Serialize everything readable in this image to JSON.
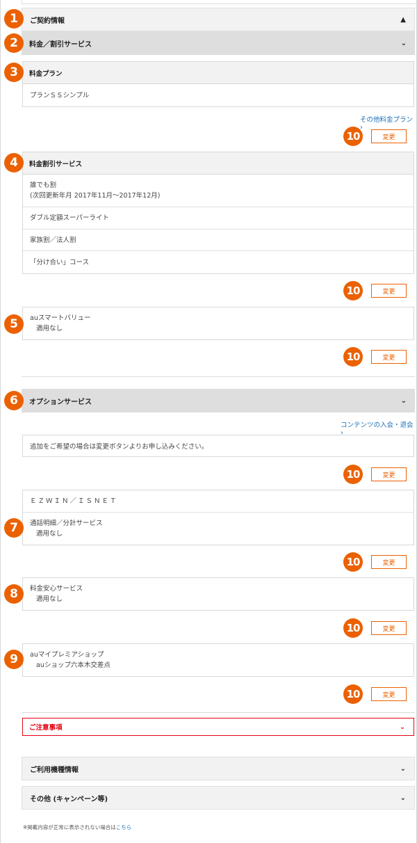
{
  "contract_header": "ご契約情報",
  "fees_header": "料金／割引サービス",
  "plan": {
    "title": "料金プラン",
    "name": "プランＳＳシンプル"
  },
  "other_plans_link": "その他料金プラン ›",
  "discounts": {
    "title": "料金割引サービス",
    "item1_line1": "誰でも割",
    "item1_line2": "(次回更新年月 2017年11月～2017年12月)",
    "item2": "ダブル定額スーパーライト",
    "item3": "家族割／法人割",
    "item4": "「分け合い」コース"
  },
  "smart_value": {
    "name": "auスマートバリュー",
    "status": "適用なし"
  },
  "options_header": "オプションサービス",
  "contents_link": "コンテンツの入会・退会 ›",
  "options_hint": "追加をご希望の場合は変更ボタンよりお申し込みください。",
  "ezweb": {
    "name": "ＥＺＷＩＮ／ＩＳＮＥＴ",
    "sub_name": "通話明細／分計サービス",
    "sub_status": "適用なし"
  },
  "anshin": {
    "name": "料金安心サービス",
    "status": "適用なし"
  },
  "premier": {
    "name": "auマイプレミアショップ",
    "shop": "auショップ六本木交差点"
  },
  "change_label": "変更",
  "notice_header": "ご注意事項",
  "device_header": "ご利用機種情報",
  "campaign_header": "その他 (キャンペーン等)",
  "footnote_text": "※掲載内容が正常に表示されない場合は",
  "footnote_link": "こちら",
  "icons": {
    "collapse": "chevron-up-icon",
    "expand": "chevron-down-icon"
  },
  "badges": [
    "1",
    "2",
    "3",
    "4",
    "5",
    "6",
    "7",
    "8",
    "9",
    "10"
  ],
  "colors": {
    "accent": "#eb6100",
    "alert": "#e60012",
    "link": "#1a6fb5"
  }
}
